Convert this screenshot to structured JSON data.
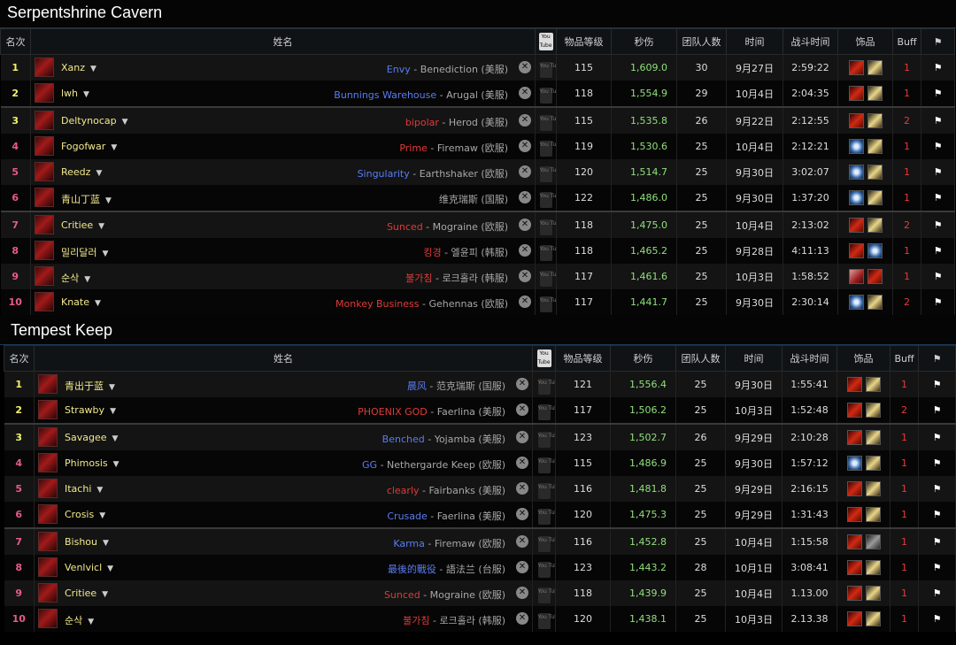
{
  "headers": {
    "rank": "名次",
    "name": "姓名",
    "youtube": "You Tube",
    "ilvl": "物品等级",
    "dps": "秒伤",
    "size": "团队人数",
    "date": "时间",
    "fight": "战斗时间",
    "equip": "饰品",
    "buff": "Buff",
    "flag": "⚑"
  },
  "sections": [
    {
      "title": "Serpentshrine Cavern",
      "rows": [
        {
          "rank": "1",
          "name": "Xanz",
          "guild": "Envy",
          "guild_color": "#5a7cf0",
          "server": "Benediction (美服)",
          "ilvl": "115",
          "dps": "1,609.0",
          "size": "30",
          "date": "9月27日",
          "time": "2:59:22",
          "equip": [
            "red",
            "gold"
          ],
          "buff": "1"
        },
        {
          "rank": "2",
          "name": "lwh",
          "guild": "Bunnings Warehouse",
          "guild_color": "#5a7cf0",
          "server": "Arugal (美服)",
          "ilvl": "118",
          "dps": "1,554.9",
          "size": "29",
          "date": "10月4日",
          "time": "2:04:35",
          "equip": [
            "red",
            "gold"
          ],
          "buff": "1"
        },
        {
          "rank": "3",
          "name": "Deltynocap",
          "guild": "bipolar",
          "guild_color": "#e03a3a",
          "server": "Herod (美服)",
          "ilvl": "115",
          "dps": "1,535.8",
          "size": "26",
          "date": "9月22日",
          "time": "2:12:55",
          "equip": [
            "red",
            "gold"
          ],
          "buff": "2"
        },
        {
          "rank": "4",
          "name": "Fogofwar",
          "guild": "Prime",
          "guild_color": "#e03a3a",
          "server": "Firemaw (欧服)",
          "ilvl": "119",
          "dps": "1,530.6",
          "size": "25",
          "date": "10月4日",
          "time": "2:12:21",
          "equip": [
            "blue",
            "gold"
          ],
          "buff": "1"
        },
        {
          "rank": "5",
          "name": "Reedz",
          "guild": "Singularity",
          "guild_color": "#5a7cf0",
          "server": "Earthshaker (欧服)",
          "ilvl": "120",
          "dps": "1,514.7",
          "size": "25",
          "date": "9月30日",
          "time": "3:02:07",
          "equip": [
            "blue",
            "gold"
          ],
          "buff": "1"
        },
        {
          "rank": "6",
          "name": "青山丁蓝",
          "guild": "",
          "guild_color": "#5a7cf0",
          "server": "维克瑞斯 (国服)",
          "ilvl": "122",
          "dps": "1,486.0",
          "size": "25",
          "date": "9月30日",
          "time": "1:37:20",
          "equip": [
            "blue",
            "gold"
          ],
          "buff": "1"
        },
        {
          "rank": "7",
          "name": "Critiee",
          "guild": "Sunced",
          "guild_color": "#e03a3a",
          "server": "Mograine (欧服)",
          "ilvl": "118",
          "dps": "1,475.0",
          "size": "25",
          "date": "10月4日",
          "time": "2:13:02",
          "equip": [
            "red",
            "gold"
          ],
          "buff": "2"
        },
        {
          "rank": "8",
          "name": "밀리달러",
          "guild": "킹경",
          "guild_color": "#e03a3a",
          "server": "엘윤피 (韩服)",
          "ilvl": "118",
          "dps": "1,465.2",
          "size": "25",
          "date": "9月28日",
          "time": "4:11:13",
          "equip": [
            "red",
            "blue"
          ],
          "buff": "1"
        },
        {
          "rank": "9",
          "name": "순삭",
          "guild": "불가침",
          "guild_color": "#e03a3a",
          "server": "로크홀라 (韩服)",
          "ilvl": "117",
          "dps": "1,461.6",
          "size": "25",
          "date": "10月3日",
          "time": "1:58:52",
          "equip": [
            "mixed",
            "red"
          ],
          "buff": "1"
        },
        {
          "rank": "10",
          "name": "Knate",
          "guild": "Monkey Business",
          "guild_color": "#e03a3a",
          "server": "Gehennas (欧服)",
          "ilvl": "117",
          "dps": "1,441.7",
          "size": "25",
          "date": "9月30日",
          "time": "2:30:14",
          "equip": [
            "blue",
            "gold"
          ],
          "buff": "2"
        }
      ]
    },
    {
      "title": "Tempest Keep",
      "rows": [
        {
          "rank": "1",
          "name": "青出于蓝",
          "guild": "晨风",
          "guild_color": "#5a7cf0",
          "server": "范克瑞斯 (国服)",
          "ilvl": "121",
          "dps": "1,556.4",
          "size": "25",
          "date": "9月30日",
          "time": "1:55:41",
          "equip": [
            "red",
            "gold"
          ],
          "buff": "1"
        },
        {
          "rank": "2",
          "name": "Strawby",
          "guild": "PHOENIX GOD",
          "guild_color": "#e03a3a",
          "server": "Faerlina (美服)",
          "ilvl": "117",
          "dps": "1,506.2",
          "size": "25",
          "date": "10月3日",
          "time": "1:52:48",
          "equip": [
            "red",
            "gold"
          ],
          "buff": "2"
        },
        {
          "rank": "3",
          "name": "Savagee",
          "guild": "Benched",
          "guild_color": "#5a7cf0",
          "server": "Yojamba (美服)",
          "ilvl": "123",
          "dps": "1,502.7",
          "size": "26",
          "date": "9月29日",
          "time": "2:10:28",
          "equip": [
            "red",
            "gold"
          ],
          "buff": "1"
        },
        {
          "rank": "4",
          "name": "Phimosis",
          "guild": "GG",
          "guild_color": "#5a7cf0",
          "server": "Nethergarde Keep (欧服)",
          "ilvl": "115",
          "dps": "1,486.9",
          "size": "25",
          "date": "9月30日",
          "time": "1:57:12",
          "equip": [
            "blue",
            "gold"
          ],
          "buff": "1"
        },
        {
          "rank": "5",
          "name": "Itachi",
          "guild": "clearly",
          "guild_color": "#e03a3a",
          "server": "Fairbanks (美服)",
          "ilvl": "116",
          "dps": "1,481.8",
          "size": "25",
          "date": "9月29日",
          "time": "2:16:15",
          "equip": [
            "red",
            "gold"
          ],
          "buff": "1"
        },
        {
          "rank": "6",
          "name": "Crosis",
          "guild": "Crusade",
          "guild_color": "#5a7cf0",
          "server": "Faerlina (美服)",
          "ilvl": "120",
          "dps": "1,475.3",
          "size": "25",
          "date": "9月29日",
          "time": "1:31:43",
          "equip": [
            "red",
            "gold"
          ],
          "buff": "1"
        },
        {
          "rank": "7",
          "name": "Bishou",
          "guild": "Karma",
          "guild_color": "#5a7cf0",
          "server": "Firemaw (欧服)",
          "ilvl": "116",
          "dps": "1,452.8",
          "size": "25",
          "date": "10月4日",
          "time": "1:15:58",
          "equip": [
            "red",
            "grey"
          ],
          "buff": "1"
        },
        {
          "rank": "8",
          "name": "Venlvicl",
          "guild": "最後的戰役",
          "guild_color": "#5a7cf0",
          "server": "語法兰 (台服)",
          "ilvl": "123",
          "dps": "1,443.2",
          "size": "28",
          "date": "10月1日",
          "time": "3:08:41",
          "equip": [
            "red",
            "gold"
          ],
          "buff": "1"
        },
        {
          "rank": "9",
          "name": "Critiee",
          "guild": "Sunced",
          "guild_color": "#e03a3a",
          "server": "Mograine (欧服)",
          "ilvl": "118",
          "dps": "1,439.9",
          "size": "25",
          "date": "10月4日",
          "time": "1.13.00",
          "equip": [
            "red",
            "gold"
          ],
          "buff": "1"
        },
        {
          "rank": "10",
          "name": "순삭",
          "guild": "불가침",
          "guild_color": "#e03a3a",
          "server": "로크홀라 (韩服)",
          "ilvl": "120",
          "dps": "1,438.1",
          "size": "25",
          "date": "10月3日",
          "time": "2.13.38",
          "equip": [
            "red",
            "gold"
          ],
          "buff": "1"
        }
      ]
    }
  ]
}
